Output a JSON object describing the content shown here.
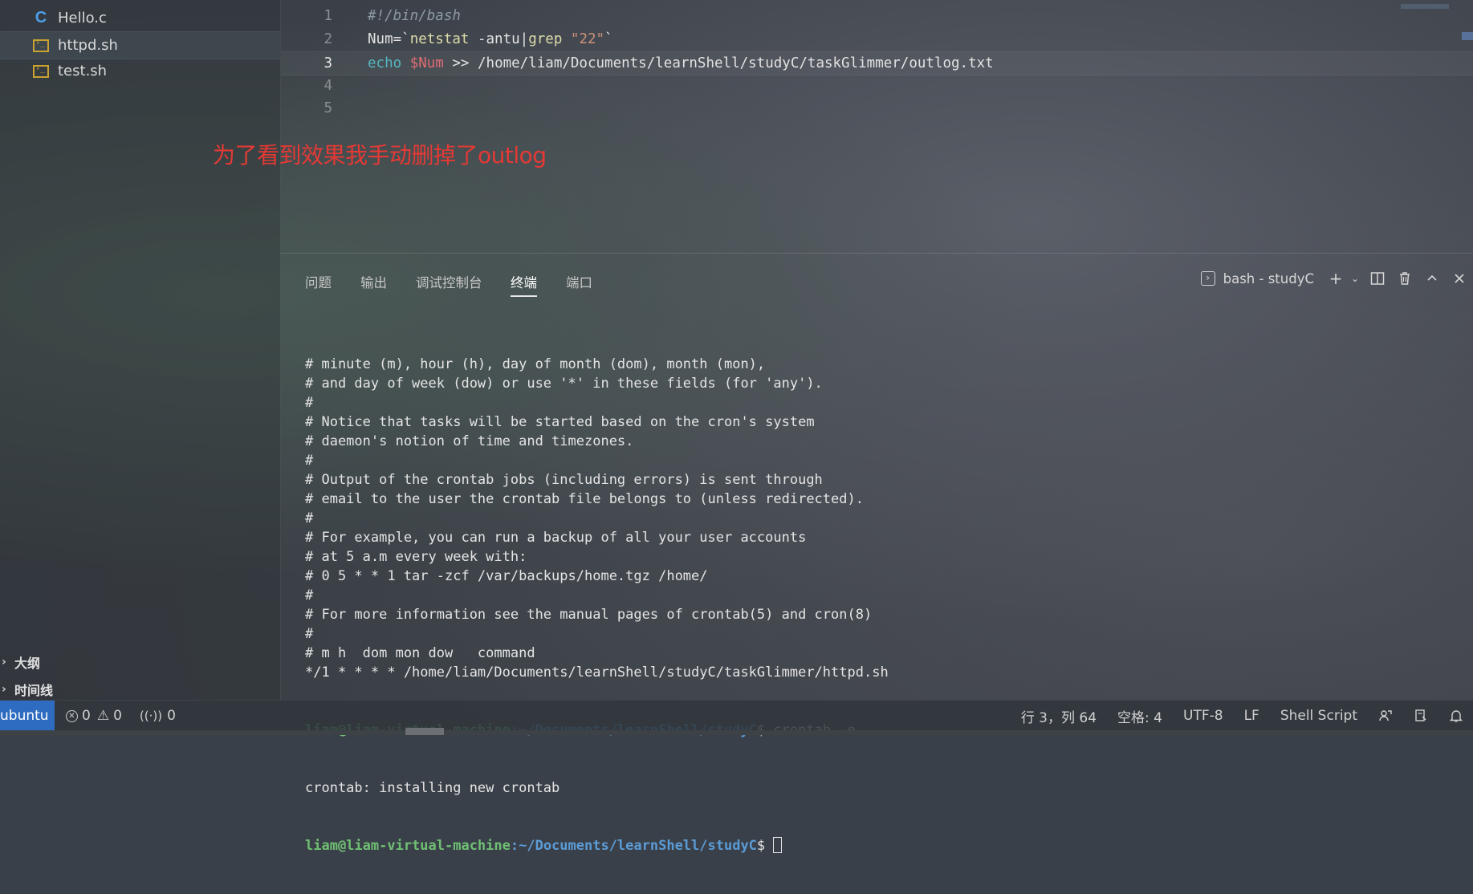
{
  "sidebar": {
    "files": [
      {
        "name": "Hello.c",
        "icon": "c-file-icon"
      },
      {
        "name": "httpd.sh",
        "icon": "shell-file-icon"
      },
      {
        "name": "test.sh",
        "icon": "shell-file-icon"
      }
    ],
    "sections": [
      {
        "label": "大纲"
      },
      {
        "label": "时间线"
      }
    ]
  },
  "editor": {
    "lines": [
      {
        "num": "1",
        "segments": [
          {
            "t": "#!/bin/bash",
            "c": "comment"
          }
        ]
      },
      {
        "num": "2",
        "segments": [
          {
            "t": "Num=`",
            "c": "plain"
          },
          {
            "t": "netstat",
            "c": "cmd"
          },
          {
            "t": " -antu|",
            "c": "plain"
          },
          {
            "t": "grep",
            "c": "cmd"
          },
          {
            "t": " \"22\"",
            "c": "str"
          },
          {
            "t": "`",
            "c": "plain"
          }
        ]
      },
      {
        "num": "3",
        "segments": [
          {
            "t": "echo",
            "c": "kw"
          },
          {
            "t": " ",
            "c": "plain"
          },
          {
            "t": "$Num",
            "c": "var"
          },
          {
            "t": " >> /home/liam/Documents/learnShell/studyC/taskGlimmer/outlog.txt",
            "c": "plain"
          }
        ]
      },
      {
        "num": "4",
        "segments": []
      },
      {
        "num": "5",
        "segments": []
      }
    ],
    "current_line": "3",
    "annotation": "为了看到效果我手动删掉了outlog"
  },
  "panel": {
    "tabs": [
      "问题",
      "输出",
      "调试控制台",
      "终端",
      "端口"
    ],
    "active_tab": "终端",
    "terminal_name": "bash - studyC",
    "terminal_lines": [
      "# minute (m), hour (h), day of month (dom), month (mon),",
      "# and day of week (dow) or use '*' in these fields (for 'any').",
      "#",
      "# Notice that tasks will be started based on the cron's system",
      "# daemon's notion of time and timezones.",
      "#",
      "# Output of the crontab jobs (including errors) is sent through",
      "# email to the user the crontab file belongs to (unless redirected).",
      "#",
      "# For example, you can run a backup of all your user accounts",
      "# at 5 a.m every week with:",
      "# 0 5 * * 1 tar -zcf /var/backups/home.tgz /home/",
      "#",
      "# For more information see the manual pages of crontab(5) and cron(8)",
      "#",
      "# m h  dom mon dow   command",
      "*/1 * * * * /home/liam/Documents/learnShell/studyC/taskGlimmer/httpd.sh"
    ],
    "prompt_user": "liam@liam-virtual-machine",
    "prompt_path": ":~/Documents/learnShell/studyC",
    "prompt_symbol": "$ ",
    "command": "crontab -e",
    "output": "crontab: installing new crontab"
  },
  "statusbar": {
    "remote": "ubuntu",
    "errors": "0",
    "warnings": "0",
    "ports": "0",
    "position": "行 3，列 64",
    "spaces": "空格: 4",
    "encoding": "UTF-8",
    "eol": "LF",
    "language": "Shell Script"
  },
  "colors": {
    "accent_remote": "#2d6cc0",
    "annotation": "#e53935",
    "prompt_user": "#6fbf73",
    "prompt_path": "#5b9bd5"
  }
}
